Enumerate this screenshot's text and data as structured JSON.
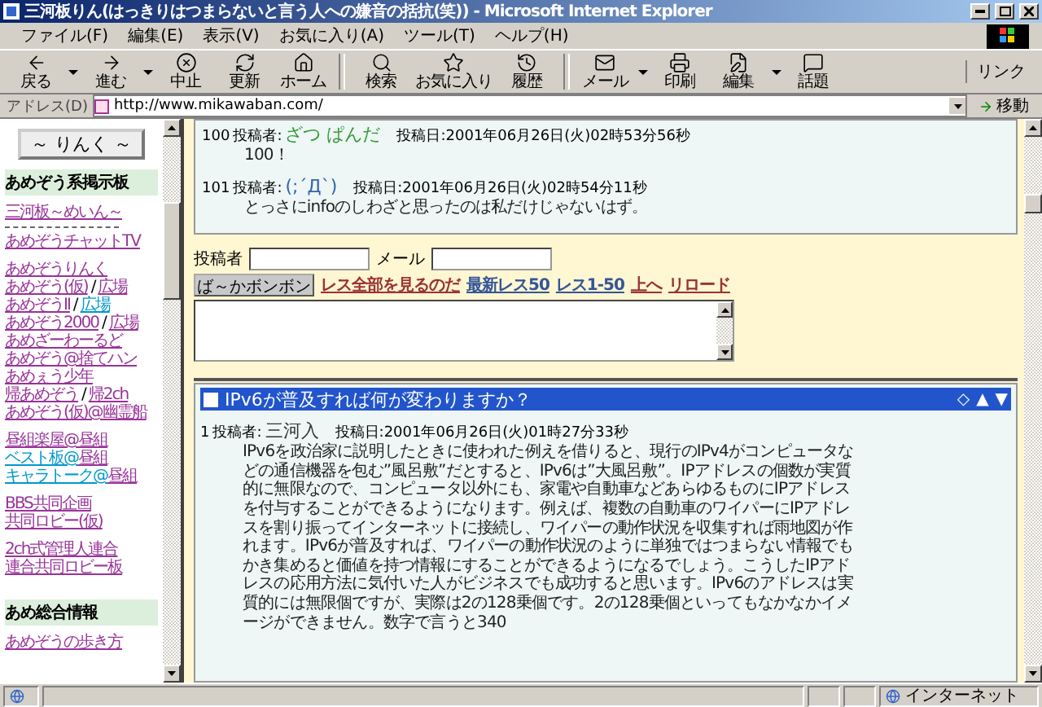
{
  "window": {
    "title": "三河板りん(はっきりはつまらないと言う人への嫌音の括抗(笑)) - Microsoft Internet Explorer"
  },
  "menu": [
    "ファイル(F)",
    "編集(E)",
    "表示(V)",
    "お気に入り(A)",
    "ツール(T)",
    "ヘルプ(H)"
  ],
  "toolbar": [
    [
      {
        "label": "戻る",
        "dropdown": true
      },
      {
        "label": "進む",
        "dropdown": true
      },
      {
        "label": "中止",
        "dropdown": false
      },
      {
        "label": "更新",
        "dropdown": false
      },
      {
        "label": "ホーム",
        "dropdown": false
      }
    ],
    [
      {
        "label": "検索",
        "dropdown": false
      },
      {
        "label": "お気に入り",
        "dropdown": false
      },
      {
        "label": "履歴",
        "dropdown": false
      }
    ],
    [
      {
        "label": "メール",
        "dropdown": true
      },
      {
        "label": "印刷",
        "dropdown": false
      },
      {
        "label": "編集",
        "dropdown": true
      },
      {
        "label": "話題",
        "dropdown": false
      }
    ]
  ],
  "links_label": "リンク",
  "address": {
    "label": "アドレス(D)",
    "url": "http://www.mikawaban.com/",
    "go": "移動"
  },
  "sidebar": {
    "button": "～ りんく ～",
    "sections": [
      {
        "title": "あめぞう系掲示板",
        "groups": [
          [
            [
              {
                "text": "三河板～めいん～",
                "visited": true
              }
            ],
            [
              {
                "kind": "dash"
              }
            ],
            [
              {
                "text": "あめぞうチャットTV",
                "visited": true
              }
            ]
          ],
          [
            [
              {
                "text": "あめぞうりんく",
                "visited": true
              }
            ],
            [
              {
                "text": "あめぞう(仮)",
                "visited": true
              },
              {
                "kind": "sep",
                "text": "/"
              },
              {
                "text": "広場",
                "visited": true
              }
            ],
            [
              {
                "text": "あめぞうII",
                "visited": true
              },
              {
                "kind": "sep",
                "text": "/"
              },
              {
                "text": "広場",
                "visited": false
              }
            ],
            [
              {
                "text": "あめぞう2000",
                "visited": true
              },
              {
                "kind": "sep",
                "text": "/"
              },
              {
                "text": "広場",
                "visited": true
              }
            ],
            [
              {
                "text": "あめざーわーるど",
                "visited": true
              }
            ],
            [
              {
                "text": "あめぞう@捨てハン",
                "visited": true
              }
            ],
            [
              {
                "text": "あめぇう少年",
                "visited": true
              }
            ],
            [
              {
                "text": "帰あめぞう",
                "visited": true
              },
              {
                "kind": "sep",
                "text": "/"
              },
              {
                "text": "帰2ch",
                "visited": true
              }
            ],
            [
              {
                "text": "あめぞう(仮)@幽霊船",
                "visited": true
              }
            ]
          ],
          [
            [
              {
                "text": "昼組楽屋@",
                "visited": true
              },
              {
                "text": "昼組",
                "visited": true
              }
            ],
            [
              {
                "text": "ベスト板@",
                "visited": false
              },
              {
                "text": "昼組",
                "visited": true
              }
            ],
            [
              {
                "text": "キャラトーク@",
                "visited": false
              },
              {
                "text": "昼組",
                "visited": true
              }
            ]
          ],
          [
            [
              {
                "text": "BBS共同企画",
                "visited": true
              }
            ],
            [
              {
                "text": "共同ロビー(仮)",
                "visited": true
              }
            ]
          ],
          [
            [
              {
                "text": "2ch式管理人連合",
                "visited": true
              }
            ],
            [
              {
                "text": "連合共同ロビー板",
                "visited": true
              }
            ]
          ]
        ]
      },
      {
        "title": "あめ総合情報",
        "groups": [
          [
            [
              {
                "text": "あめぞうの歩き方",
                "visited": true
              }
            ]
          ]
        ]
      }
    ]
  },
  "thread1": {
    "posts": [
      {
        "number": "100",
        "author_label": "投稿者:",
        "name": "ざつ ぱんだ",
        "date": "投稿日:2001年06月26日(火)02時53分56秒",
        "body": "100！",
        "color": "#339933"
      },
      {
        "number": "101",
        "author_label": "投稿者:",
        "name": "(;´Д`)",
        "date": "投稿日:2001年06月26日(火)02時54分11秒",
        "body": "とっさにinfoのしわざと思ったのは私だけじゃないはず。",
        "color": "#3366aa"
      }
    ]
  },
  "form": {
    "name_label": "投稿者",
    "mail_label": "メール",
    "submit": "ば～かボンボン",
    "links": [
      {
        "text": "レス全部を見るのだ",
        "color": "#993333"
      },
      {
        "text": "最新レス50",
        "color": "#335599"
      },
      {
        "text": "レス1-50",
        "color": "#335599"
      },
      {
        "text": "上へ",
        "color": "#993333"
      },
      {
        "text": "リロード",
        "color": "#993333"
      }
    ]
  },
  "thread2": {
    "title": "IPv6が普及すれば何が変わりますか？",
    "nav": [
      "◇",
      "▲",
      "▼"
    ],
    "posts": [
      {
        "number": "1",
        "author_label": "投稿者:",
        "name": "三河入",
        "date": "投稿日:2001年06月26日(火)01時27分33秒",
        "color": "#333333",
        "body": "IPv6を政治家に説明したときに使われた例えを借りると、現行のIPv4がコンピュータなどの通信機器を包む”風呂敷”だとすると、IPv6は”大風呂敷”。IPアドレスの個数が実質的に無限なので、コンピュータ以外にも、家電や自動車などあらゆるものにIPアドレスを付与することができるようになります。例えば、複数の自動車のワイパーにIPアドレスを割り振ってインターネットに接続し、ワイパーの動作状況を収集すれば雨地図が作れます。IPv6が普及すれば、ワイパーの動作状況のように単独ではつまらない情報でもかき集めると価値を持つ情報にすることができるようになるでしょう。こうしたIPアドレスの応用方法に気付いた人がビジネスでも成功すると思います。IPv6のアドレスは実質的には無限個ですが、実際は2の128乗個です。2の128乗個といってもなかなかイメージができません。数字で言うと340"
      }
    ]
  },
  "status": {
    "zone": "インターネット"
  }
}
